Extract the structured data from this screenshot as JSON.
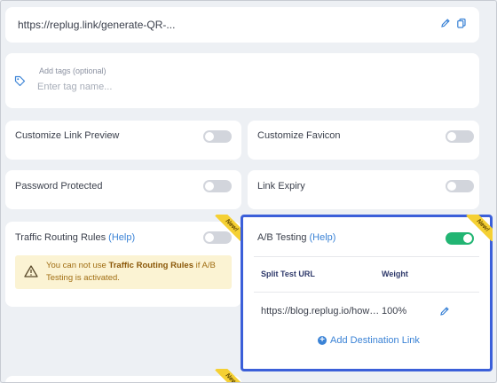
{
  "url": {
    "value": "https://replug.link/generate-QR-..."
  },
  "tags": {
    "label": "Add tags (optional)",
    "placeholder": "Enter tag name..."
  },
  "options": {
    "customize_link_preview": {
      "label": "Customize Link Preview",
      "enabled": false
    },
    "customize_favicon": {
      "label": "Customize Favicon",
      "enabled": false
    },
    "password_protected": {
      "label": "Password Protected",
      "enabled": false
    },
    "link_expiry": {
      "label": "Link Expiry",
      "enabled": false
    },
    "traffic_routing": {
      "label": "Traffic Routing Rules",
      "help": "(Help)",
      "enabled": false,
      "badge": "New!",
      "warning_prefix": "You can not use ",
      "warning_bold": "Traffic Routing Rules",
      "warning_suffix": " if A/B Testing is activated."
    },
    "ab_testing": {
      "label": "A/B Testing",
      "help": "(Help)",
      "enabled": true,
      "badge": "New!",
      "columns": [
        "Split Test URL",
        "Weight"
      ],
      "rows": [
        {
          "url": "https://blog.replug.io/how…",
          "weight": "100%"
        }
      ],
      "add_link_label": "Add Destination Link"
    },
    "next_badge": "New!"
  },
  "colors": {
    "accent_blue": "#3b83d6",
    "highlight_border": "#3b5fd9",
    "toggle_on": "#22b573",
    "warning_bg": "#fbf3d3",
    "badge_yellow": "#f5d033"
  }
}
